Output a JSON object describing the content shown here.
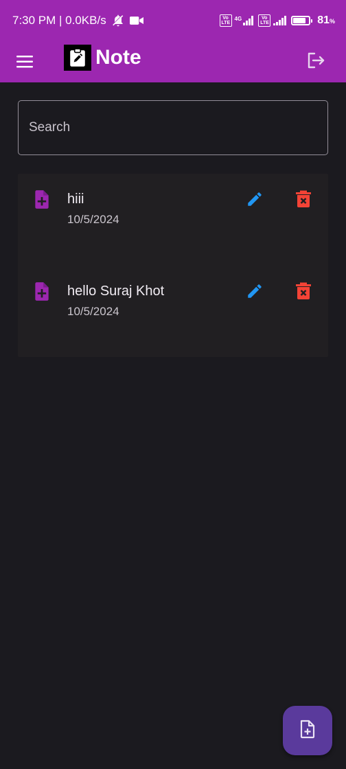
{
  "status_bar": {
    "time_speed": "7:30 PM | 0.0KB/s",
    "network_label": "4G",
    "volte_label": "Vo LTE",
    "battery_percent": 81,
    "battery_text": "81",
    "battery_suffix": "%"
  },
  "app_bar": {
    "title": "Note",
    "menu_icon": "hamburger-menu-icon",
    "logo_icon": "note-edit-icon",
    "logout_icon": "logout-icon"
  },
  "search": {
    "placeholder": "Search",
    "value": ""
  },
  "notes": [
    {
      "title": "hiii",
      "date": "10/5/2024"
    },
    {
      "title": "hello Suraj Khot",
      "date": "10/5/2024"
    }
  ],
  "fab": {
    "icon": "note-add-icon"
  },
  "colors": {
    "primary": "#9c27b0",
    "background": "#1b1a1f",
    "card": "#211f22",
    "edit": "#2196f3",
    "delete": "#f44336",
    "fab": "#5a3a9c"
  }
}
